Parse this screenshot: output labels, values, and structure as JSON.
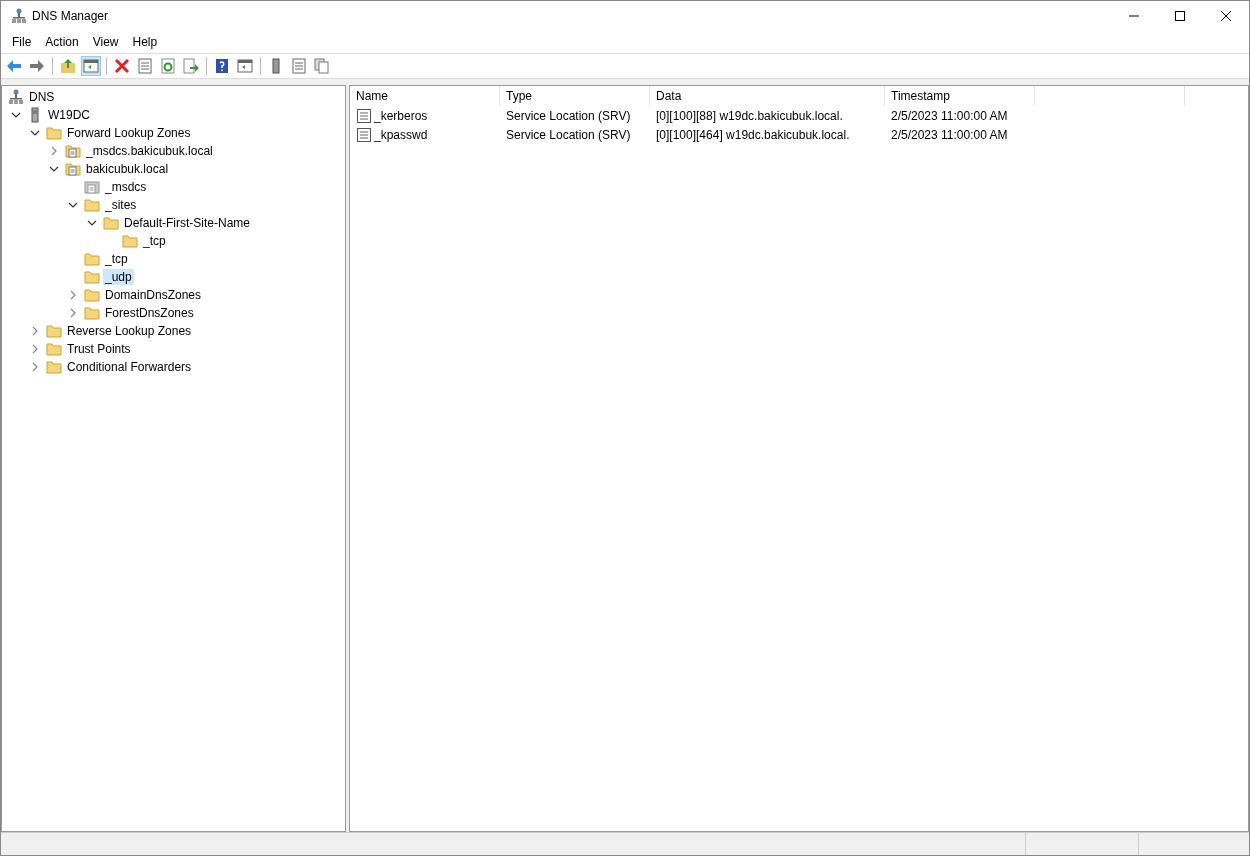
{
  "window": {
    "title": "DNS Manager"
  },
  "menu": [
    "File",
    "Action",
    "View",
    "Help"
  ],
  "toolbar": [
    [
      {
        "kind": "back",
        "pressed": false
      },
      {
        "kind": "forward",
        "pressed": false
      }
    ],
    [
      {
        "kind": "up",
        "pressed": false
      },
      {
        "kind": "console-tree",
        "pressed": true
      }
    ],
    [
      {
        "kind": "delete",
        "pressed": false
      },
      {
        "kind": "properties",
        "pressed": false
      },
      {
        "kind": "refresh",
        "pressed": false
      },
      {
        "kind": "export",
        "pressed": false
      }
    ],
    [
      {
        "kind": "help",
        "pressed": false
      },
      {
        "kind": "action-pane",
        "pressed": false
      }
    ],
    [
      {
        "kind": "server",
        "pressed": false
      },
      {
        "kind": "list",
        "pressed": false
      },
      {
        "kind": "copy",
        "pressed": false
      }
    ]
  ],
  "tree": [
    {
      "label": "DNS",
      "kind": "dns",
      "selected": false,
      "children": [
        {
          "label": "W19DC",
          "kind": "server",
          "selected": false,
          "expanded": true,
          "children": [
            {
              "label": "Forward Lookup Zones",
              "kind": "folder",
              "selected": false,
              "expanded": true,
              "children": [
                {
                  "label": "_msdcs.bakicubuk.local",
                  "kind": "zone",
                  "selected": false,
                  "expanded": false
                },
                {
                  "label": "bakicubuk.local",
                  "kind": "zone",
                  "selected": false,
                  "expanded": true,
                  "children": [
                    {
                      "label": "_msdcs",
                      "kind": "delegation",
                      "selected": false
                    },
                    {
                      "label": "_sites",
                      "kind": "folder",
                      "selected": false,
                      "expanded": true,
                      "children": [
                        {
                          "label": "Default-First-Site-Name",
                          "kind": "folder",
                          "selected": false,
                          "expanded": true,
                          "children": [
                            {
                              "label": "_tcp",
                              "kind": "folder",
                              "selected": false
                            }
                          ]
                        }
                      ]
                    },
                    {
                      "label": "_tcp",
                      "kind": "folder",
                      "selected": false
                    },
                    {
                      "label": "_udp",
                      "kind": "folder",
                      "selected": true
                    },
                    {
                      "label": "DomainDnsZones",
                      "kind": "folder",
                      "selected": false,
                      "expanded": false
                    },
                    {
                      "label": "ForestDnsZones",
                      "kind": "folder",
                      "selected": false,
                      "expanded": false
                    }
                  ]
                }
              ]
            },
            {
              "label": "Reverse Lookup Zones",
              "kind": "folder",
              "selected": false,
              "expanded": false
            },
            {
              "label": "Trust Points",
              "kind": "folder",
              "selected": false,
              "expanded": false
            },
            {
              "label": "Conditional Forwarders",
              "kind": "folder",
              "selected": false,
              "expanded": false
            }
          ]
        }
      ]
    }
  ],
  "table": {
    "columns": [
      "Name",
      "Type",
      "Data",
      "Timestamp"
    ],
    "rows": [
      {
        "name": "_kerberos",
        "type": "Service Location (SRV)",
        "data": "[0][100][88] w19dc.bakicubuk.local.",
        "timestamp": "2/5/2023 11:00:00 AM"
      },
      {
        "name": "_kpasswd",
        "type": "Service Location (SRV)",
        "data": "[0][100][464] w19dc.bakicubuk.local.",
        "timestamp": "2/5/2023 11:00:00 AM"
      }
    ]
  }
}
